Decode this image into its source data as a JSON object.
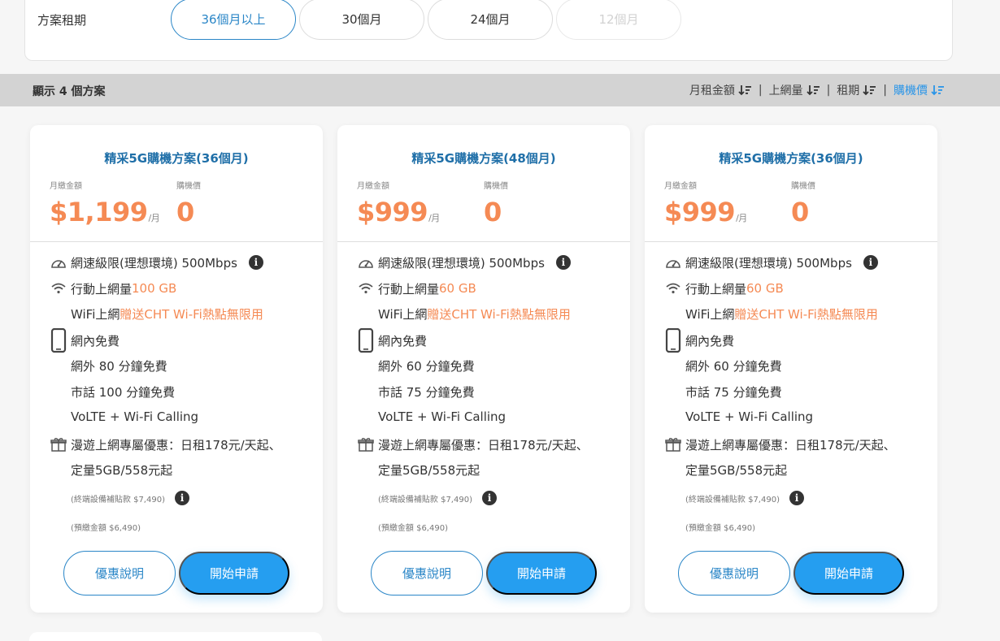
{
  "filter": {
    "label": "方案租期",
    "terms": [
      {
        "label": "36個月以上",
        "state": "active"
      },
      {
        "label": "30個月",
        "state": "normal"
      },
      {
        "label": "24個月",
        "state": "normal"
      },
      {
        "label": "12個月",
        "state": "disabled"
      }
    ]
  },
  "sortbar": {
    "count_text": "顯示 4 個方案",
    "sorts": [
      {
        "label": "月租金額",
        "icon": "sort-desc-icon"
      },
      {
        "label": "上網量",
        "icon": "sort-desc-icon"
      },
      {
        "label": "租期",
        "icon": "sort-desc-icon"
      },
      {
        "label": "購機價",
        "icon": "sort-desc-icon",
        "active": true
      }
    ],
    "separator": "|"
  },
  "common": {
    "monthly_label": "月繳金額",
    "device_label": "購機價",
    "per_month": "/月",
    "btn_detail": "優惠說明",
    "btn_apply": "開始申請",
    "speed_text": "網速級限(理想環境) 500Mbps",
    "data_prefix": "行動上網量 ",
    "wifi_prefix": "WiFi上網 ",
    "wifi_value": "贈送CHT Wi-Fi熱點無限用",
    "onnet": "網內免費",
    "volte": "VoLTE + Wi-Fi Calling",
    "roam_line1": "漫遊上網專屬優惠：日租178元/天起、",
    "roam_line2": "定量5GB/558元起",
    "info_glyph": "i"
  },
  "plans": [
    {
      "title": "精采5G購機方案(36個月)",
      "price": "$1,199",
      "device_price": "0",
      "data": "100 GB",
      "offnet": "網外 80 分鐘免費",
      "local": "市話 100 分鐘免費",
      "subsidy": "(終端設備補貼款 $7,490)",
      "prepay": "(預繳金額 $6,490)"
    },
    {
      "title": "精采5G購機方案(48個月)",
      "price": "$999",
      "device_price": "0",
      "data": "60 GB",
      "offnet": "網外 60 分鐘免費",
      "local": "市話 75 分鐘免費",
      "subsidy": "(終端設備補貼款 $7,490)",
      "prepay": "(預繳金額 $6,490)"
    },
    {
      "title": "精采5G購機方案(36個月)",
      "price": "$999",
      "device_price": "0",
      "data": "60 GB",
      "offnet": "網外 60 分鐘免費",
      "local": "市話 75 分鐘免費",
      "subsidy": "(終端設備補貼款 $7,490)",
      "prepay": "(預繳金額 $6,490)"
    }
  ],
  "colors": {
    "accent": "#2a86c7",
    "button": "#259ef0",
    "price": "#f58a54"
  }
}
